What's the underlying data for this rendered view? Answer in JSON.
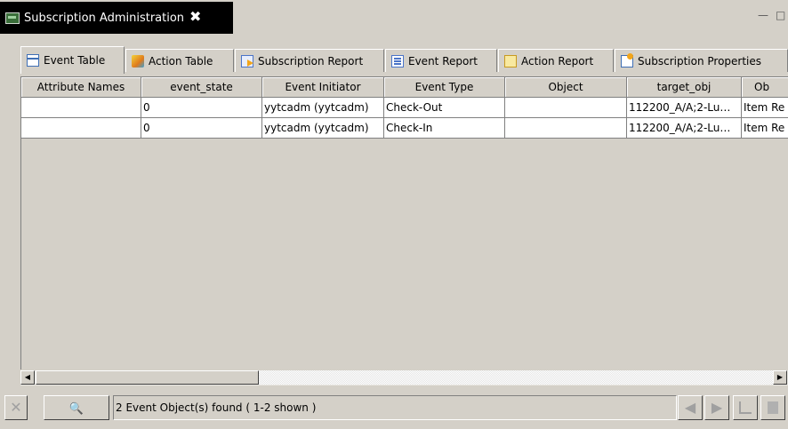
{
  "view": {
    "title": "Subscription Administration",
    "close_glyph": "✖",
    "icon": "view-icon",
    "window_controls": [
      "—",
      "□"
    ]
  },
  "tabs": [
    {
      "label": "Event Table",
      "icon": "table-icon",
      "active": true
    },
    {
      "label": "Action Table",
      "icon": "action-icon"
    },
    {
      "label": "Subscription Report",
      "icon": "report-icon"
    },
    {
      "label": "Event Report",
      "icon": "event-report-icon"
    },
    {
      "label": "Action Report",
      "icon": "action-report-icon"
    },
    {
      "label": "Subscription Properties",
      "icon": "properties-icon"
    }
  ],
  "table": {
    "columns": [
      "Attribute Names",
      "event_state",
      "Event Initiator",
      "Event Type",
      "Object",
      "target_obj",
      "Ob"
    ],
    "rows": [
      [
        "",
        "0",
        "yytcadm (yytcadm)",
        "Check-Out",
        "",
        "112200_A/A;2-Lu…",
        "Item Re"
      ],
      [
        "",
        "0",
        "yytcadm (yytcadm)",
        "Check-In",
        "",
        "112200_A/A;2-Lu…",
        "Item Re"
      ]
    ]
  },
  "status": {
    "text": "2 Event Object(s) found ( 1-2  shown )",
    "clear_glyph": "✕",
    "search_glyph": "🔍",
    "nav": [
      "◀",
      "▶"
    ]
  }
}
